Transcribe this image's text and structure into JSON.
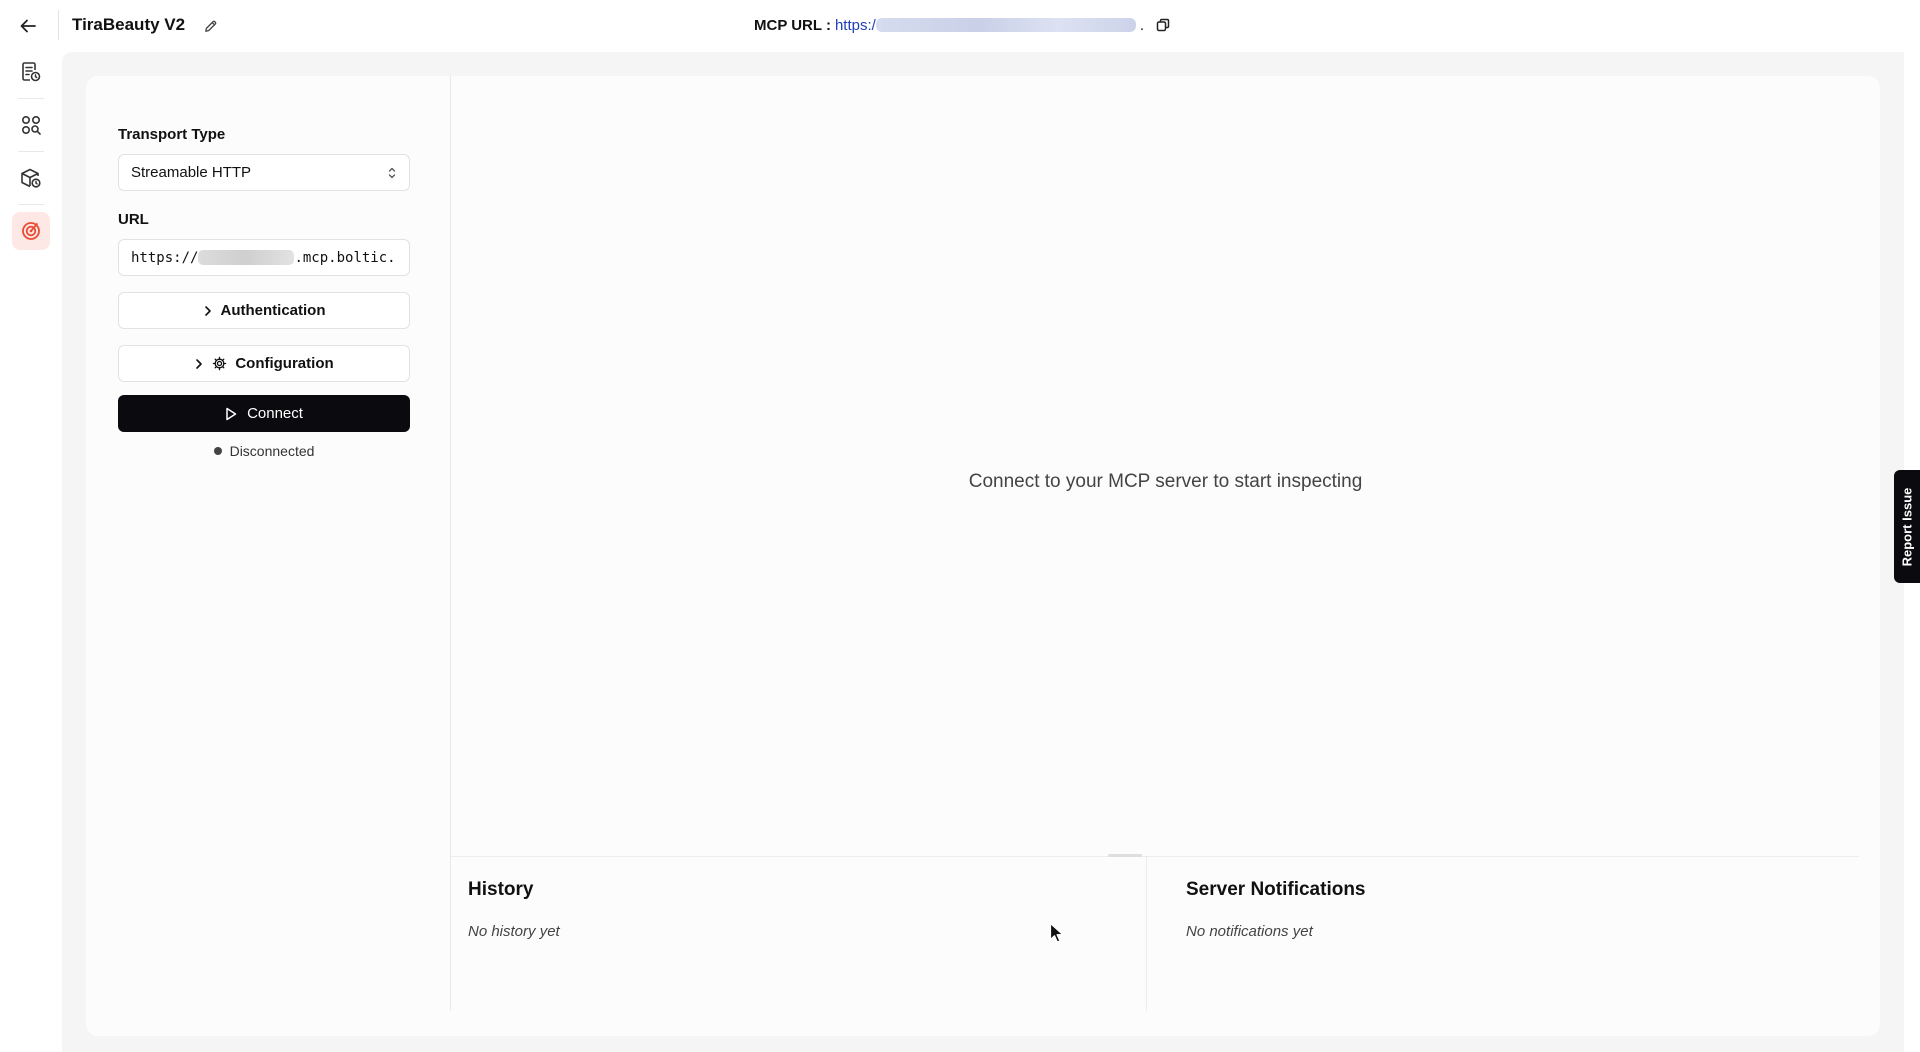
{
  "header": {
    "project_title": "TiraBeauty V2",
    "mcp_url_label": "MCP URL :",
    "mcp_url_prefix": "https:/",
    "mcp_url_suffix": "."
  },
  "sidebar": {
    "items": [
      {
        "icon": "document-clock-icon",
        "active": false
      },
      {
        "icon": "apps-search-icon",
        "active": false
      },
      {
        "icon": "package-clock-icon",
        "active": false
      },
      {
        "icon": "target-icon",
        "active": true
      }
    ],
    "accent_color": "#ea4b35"
  },
  "panel": {
    "transport_label": "Transport Type",
    "transport_value": "Streamable HTTP",
    "url_label": "URL",
    "url_prefix": "https://",
    "url_suffix": ".mcp.boltic.",
    "authentication_label": "Authentication",
    "configuration_label": "Configuration",
    "connect_label": "Connect",
    "status_text": "Disconnected"
  },
  "main": {
    "empty_message": "Connect to your MCP server to start inspecting"
  },
  "history": {
    "title": "History",
    "empty": "No history yet"
  },
  "notifications": {
    "title": "Server Notifications",
    "empty": "No notifications yet"
  },
  "report_issue_label": "Report Issue"
}
